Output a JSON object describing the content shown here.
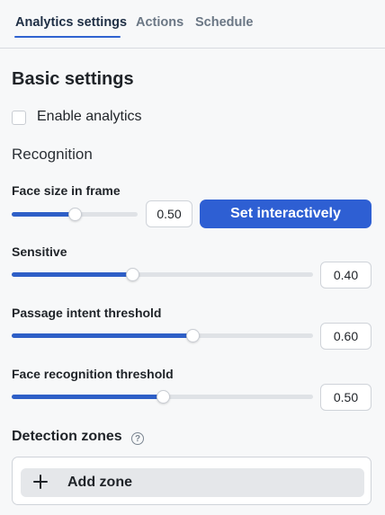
{
  "tabs": [
    {
      "label": "Analytics settings",
      "active": true
    },
    {
      "label": "Actions",
      "active": false
    },
    {
      "label": "Schedule",
      "active": false
    }
  ],
  "basic": {
    "title": "Basic settings",
    "enable_label": "Enable analytics",
    "enable_checked": false
  },
  "recognition": {
    "heading": "Recognition",
    "set_interactively_label": "Set interactively",
    "sliders": [
      {
        "label": "Face size in frame",
        "value_text": "0.50",
        "value": 0.5
      },
      {
        "label": "Sensitive",
        "value_text": "0.40",
        "value": 0.4
      },
      {
        "label": "Passage intent threshold",
        "value_text": "0.60",
        "value": 0.6
      },
      {
        "label": "Face recognition threshold",
        "value_text": "0.50",
        "value": 0.5
      }
    ]
  },
  "zones": {
    "title": "Detection zones",
    "help_icon": "question-circle-icon",
    "add_label": "Add zone",
    "add_icon": "plus-icon"
  },
  "colors": {
    "accent": "#2e5fd3",
    "slider_fill": "#2e5fc7",
    "track": "#dfe2e6"
  }
}
